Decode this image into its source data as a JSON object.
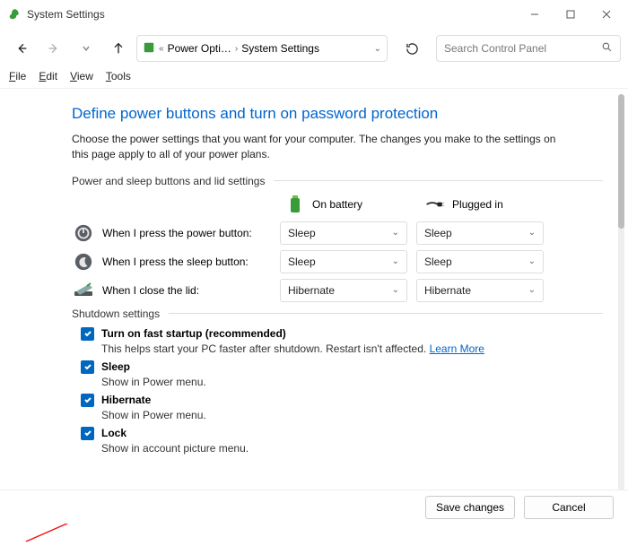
{
  "window": {
    "title": "System Settings"
  },
  "address": {
    "seg1": "Power Opti…",
    "seg2": "System Settings"
  },
  "search": {
    "placeholder": "Search Control Panel"
  },
  "menu": {
    "file": "File",
    "edit": "Edit",
    "view": "View",
    "tools": "Tools"
  },
  "page": {
    "heading": "Define power buttons and turn on password protection",
    "intro": "Choose the power settings that you want for your computer. The changes you make to the settings on this page apply to all of your power plans.",
    "group_buttons": "Power and sleep buttons and lid settings",
    "group_shutdown": "Shutdown settings",
    "col_battery": "On battery",
    "col_plugged": "Plugged in"
  },
  "rows": {
    "power": {
      "label": "When I press the power button:",
      "battery": "Sleep",
      "plugged": "Sleep"
    },
    "sleep": {
      "label": "When I press the sleep button:",
      "battery": "Sleep",
      "plugged": "Sleep"
    },
    "lid": {
      "label": "When I close the lid:",
      "battery": "Hibernate",
      "plugged": "Hibernate"
    }
  },
  "shutdown": {
    "fast": {
      "label": "Turn on fast startup (recommended)",
      "desc": "This helps start your PC faster after shutdown. Restart isn't affected. ",
      "link": "Learn More"
    },
    "sleep": {
      "label": "Sleep",
      "desc": "Show in Power menu."
    },
    "hibernate": {
      "label": "Hibernate",
      "desc": "Show in Power menu."
    },
    "lock": {
      "label": "Lock",
      "desc": "Show in account picture menu."
    }
  },
  "footer": {
    "save": "Save changes",
    "cancel": "Cancel"
  }
}
